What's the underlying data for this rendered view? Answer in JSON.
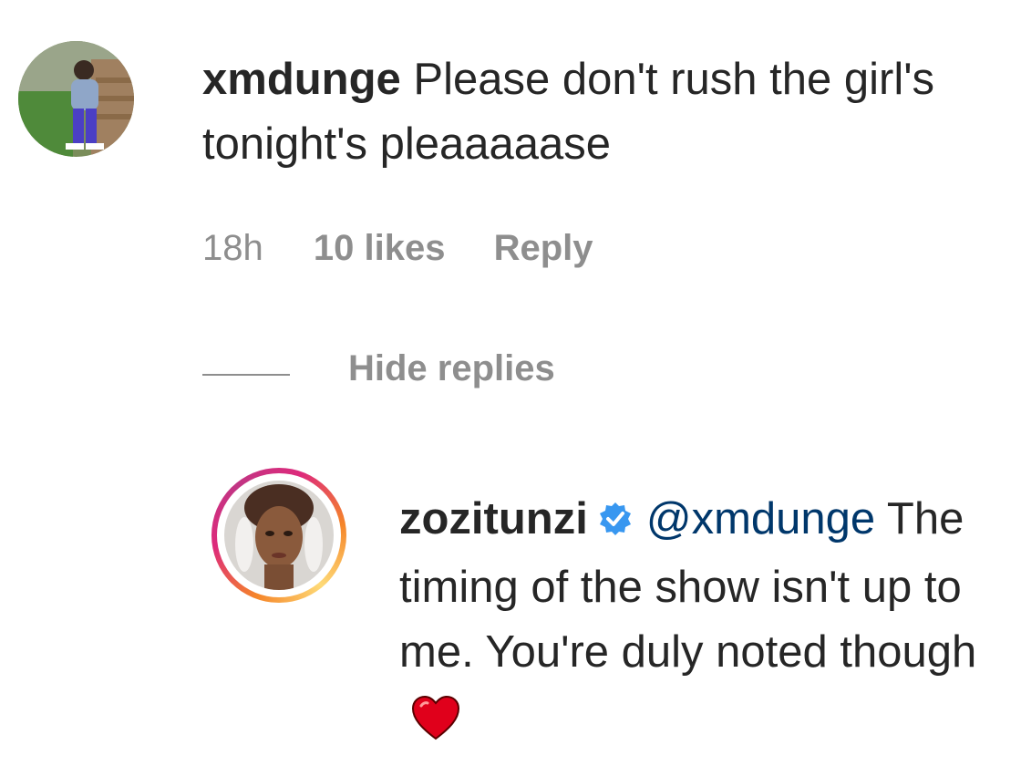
{
  "comment": {
    "username": "xmdunge",
    "text": "Please don't rush the girl's tonight's pleaaaaase",
    "time": "18h",
    "likes": "10 likes",
    "reply_label": "Reply",
    "avatar_icon": "user-avatar-photo"
  },
  "replies_toggle": {
    "label": "Hide replies"
  },
  "reply": {
    "username": "zozitunzi",
    "verified_icon": "verified-badge-icon",
    "mention": "@xmdunge",
    "text": "The timing of the show isn't up to me. You're duly noted though",
    "heart_icon": "red-heart-emoji",
    "avatar_icon": "user-avatar-photo",
    "story_ring_colors": [
      "#f58529",
      "#dd2a7b",
      "#c13584",
      "#feda77"
    ]
  },
  "colors": {
    "primary_text": "#262626",
    "secondary_text": "#8e8e8e",
    "mention": "#00376b",
    "verified": "#3897f0",
    "heart": "#e0001b"
  }
}
